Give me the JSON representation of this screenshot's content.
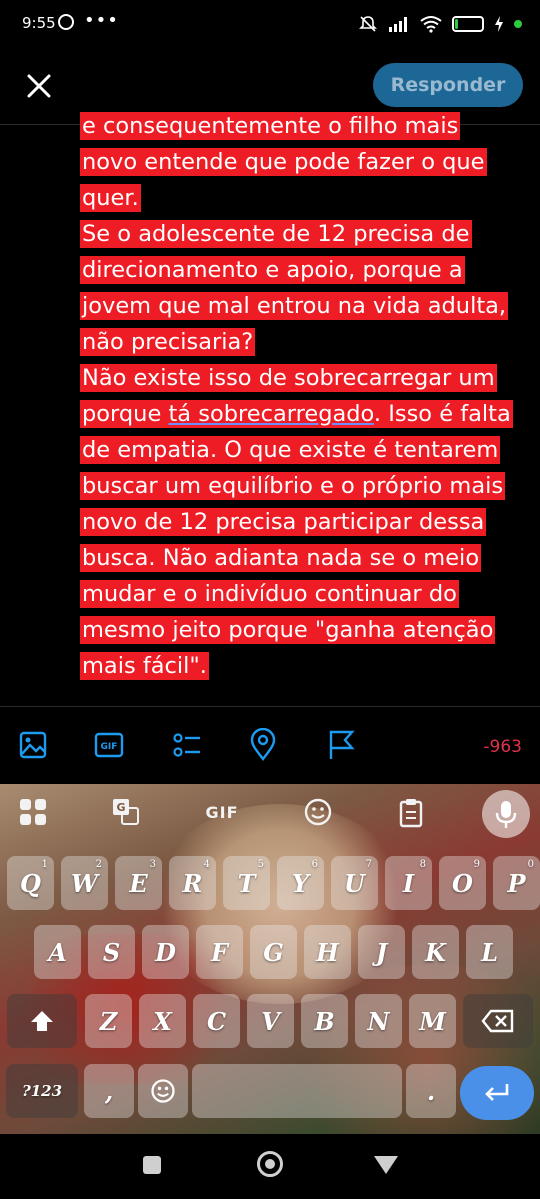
{
  "status": {
    "time": "9:55",
    "dots": "•••",
    "battery": "10"
  },
  "header": {
    "reply_label": "Responder"
  },
  "compose": {
    "lines": [
      "e consequentemente o filho mais",
      "novo entende que pode fazer o que",
      "quer.",
      "Se o adolescente de 12 precisa de",
      "direcionamento e apoio, porque a",
      "jovem que mal entrou na vida adulta,",
      "não precisaria?",
      "Não existe isso de sobrecarregar um",
      "de empatia. O que existe é tentarem",
      "buscar um equilíbrio e o próprio mais",
      "novo de 12 precisa participar dessa",
      "busca. Não adianta nada se o meio",
      "mudar e o indivíduo continuar do",
      "mesmo jeito porque \"ganha atenção",
      "mais fácil\"."
    ],
    "line_porque_start": "porque ",
    "line_porque_link": "tá sobrecarregado",
    "line_porque_end": ". Isso é falta"
  },
  "toolbar": {
    "icons": [
      "image-icon",
      "gif-icon",
      "poll-icon",
      "location-icon",
      "flag-icon"
    ],
    "gif_label": "GIF",
    "char_counter": "-963"
  },
  "keyboard": {
    "tools": {
      "gif_label": "GIF"
    },
    "row1": [
      {
        "label": "Q",
        "hint": "1"
      },
      {
        "label": "W",
        "hint": "2"
      },
      {
        "label": "E",
        "hint": "3"
      },
      {
        "label": "R",
        "hint": "4"
      },
      {
        "label": "T",
        "hint": "5"
      },
      {
        "label": "Y",
        "hint": "6"
      },
      {
        "label": "U",
        "hint": "7"
      },
      {
        "label": "I",
        "hint": "8"
      },
      {
        "label": "O",
        "hint": "9"
      },
      {
        "label": "P",
        "hint": "0"
      }
    ],
    "row2": [
      "A",
      "S",
      "D",
      "F",
      "G",
      "H",
      "J",
      "K",
      "L"
    ],
    "row3": [
      "Z",
      "X",
      "C",
      "V",
      "B",
      "N",
      "M"
    ],
    "row4": {
      "symbols": "?123",
      "comma": ",",
      "period": "."
    }
  }
}
